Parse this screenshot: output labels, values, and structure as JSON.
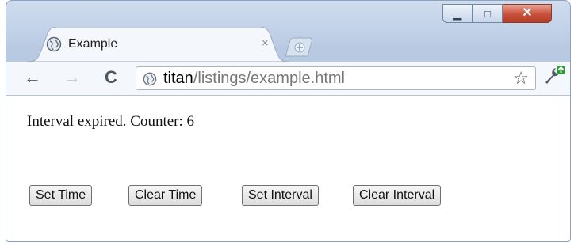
{
  "window": {
    "minimize_glyph": "▁",
    "maximize_glyph": "□",
    "close_glyph": "✕"
  },
  "tab": {
    "title": "Example",
    "close_glyph": "×"
  },
  "toolbar": {
    "back_glyph": "←",
    "forward_glyph": "→",
    "reload_glyph": "C",
    "url_host": "titan",
    "url_path": "/listings/example.html",
    "star_glyph": "☆"
  },
  "page": {
    "message": "Interval expired. Counter: 6",
    "buttons": [
      "Set Time",
      "Clear Time",
      "Set Interval",
      "Clear Interval"
    ]
  },
  "colors": {
    "frame": "#bfcfe6",
    "close_button": "#c9503a",
    "url_path": "#777777"
  }
}
